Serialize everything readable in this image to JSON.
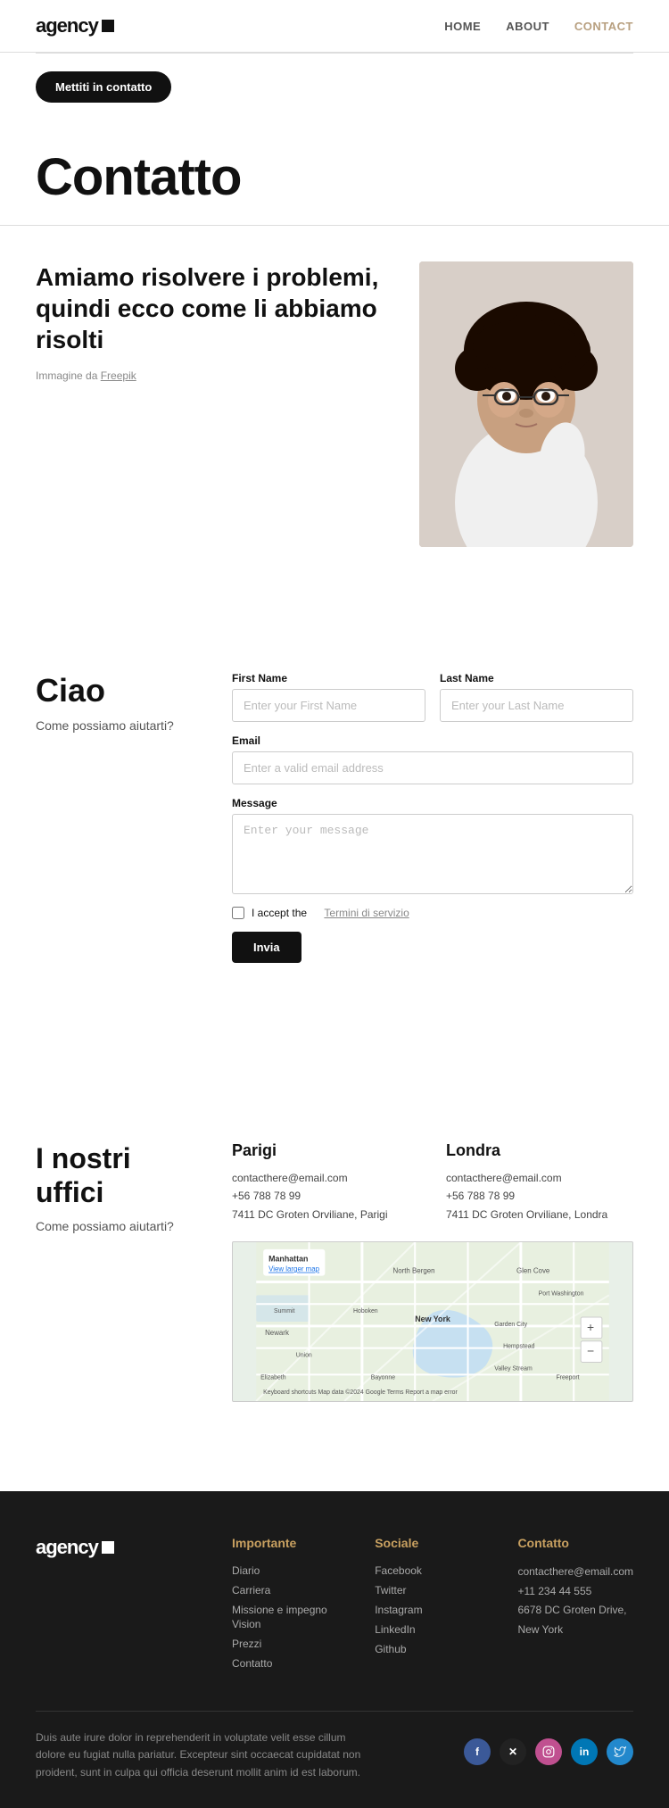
{
  "header": {
    "logo_text": "agency",
    "nav": [
      {
        "label": "HOME",
        "href": "#",
        "active": false
      },
      {
        "label": "ABOUT",
        "href": "#",
        "active": false
      },
      {
        "label": "CONTACT",
        "href": "#",
        "active": true
      }
    ]
  },
  "cta": {
    "button_label": "Mettiti in contatto"
  },
  "page_title": {
    "title": "Contatto"
  },
  "hero": {
    "heading": "Amiamo risolvere i problemi, quindi ecco come li abbiamo risolti",
    "image_caption": "Immagine da",
    "image_link_text": "Freepik"
  },
  "contact_form": {
    "greeting": "Ciao",
    "subtext": "Come possiamo aiutarti?",
    "first_name_label": "First Name",
    "first_name_placeholder": "Enter your First Name",
    "last_name_label": "Last Name",
    "last_name_placeholder": "Enter your Last Name",
    "email_label": "Email",
    "email_placeholder": "Enter a valid email address",
    "message_label": "Message",
    "message_placeholder": "Enter your message",
    "checkbox_text": "I accept the",
    "terms_link": "Termini di servizio",
    "submit_label": "Invia"
  },
  "offices": {
    "heading": "I nostri uffici",
    "subtext": "Come possiamo aiutarti?",
    "paris": {
      "city": "Parigi",
      "email": "contacthere@email.com",
      "phone": "+56 788 78 99",
      "address": "7411 DC Groten Orviliane, Parigi"
    },
    "london": {
      "city": "Londra",
      "email": "contacthere@email.com",
      "phone": "+56 788 78 99",
      "address": "7411 DC Groten Orviliane, Londra"
    },
    "map_label": "Manhattan",
    "map_link": "View larger map"
  },
  "footer": {
    "logo_text": "agency",
    "importante": {
      "title": "Importante",
      "links": [
        "Diario",
        "Carriera",
        "Missione e impegno Vision",
        "Prezzi",
        "Contatto"
      ]
    },
    "sociale": {
      "title": "Sociale",
      "links": [
        "Facebook",
        "Twitter",
        "Instagram",
        "LinkedIn",
        "Github"
      ]
    },
    "contatto": {
      "title": "Contatto",
      "email": "contacthere@email.com",
      "phone": "+11 234 44 555",
      "address": "6678 DC Groten Drive, New York"
    },
    "tagline": "Duis aute irure dolor in reprehenderit in voluptate velit esse cillum dolore eu fugiat nulla pariatur. Excepteur sint occaecat cupidatat non proident, sunt in culpa qui officia deserunt mollit anim id est laborum."
  }
}
